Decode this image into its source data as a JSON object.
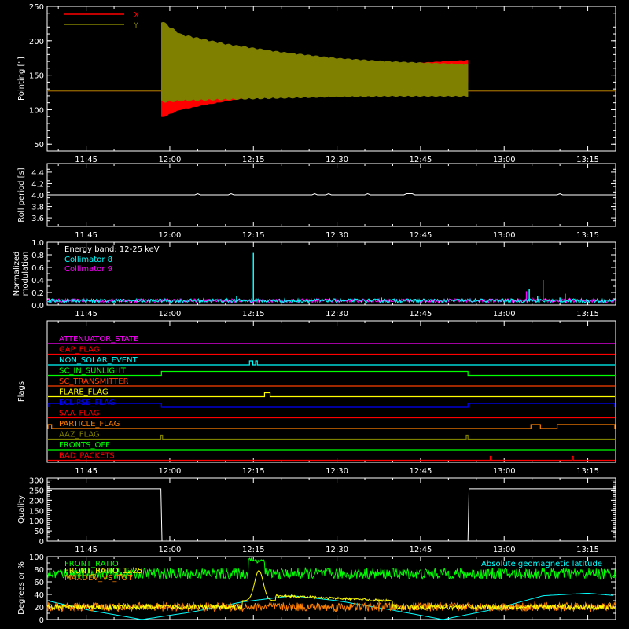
{
  "chart_data": [
    {
      "type": "line",
      "ylabel": "Pointing [\"]",
      "ylim": [
        40,
        250
      ],
      "yticks": [
        50,
        100,
        150,
        200,
        250
      ],
      "xlim": [
        38,
        140
      ],
      "xtick_minutes": [
        45,
        60,
        75,
        90,
        105,
        120,
        135
      ],
      "xtick_labels": [
        "11:45",
        "12:00",
        "12:15",
        "12:30",
        "12:45",
        "13:00",
        "13:15"
      ],
      "legend": [
        {
          "name": "X",
          "color": "#ff0000"
        },
        {
          "name": "Y",
          "color": "#808000"
        }
      ],
      "series": [
        {
          "name": "X",
          "color": "#ff0000",
          "x_start": 58.5,
          "x_end": 113.5,
          "flat_value": 127,
          "band_upper": [
            [
              58.5,
              145
            ],
            [
              62,
              143
            ],
            [
              70,
              145
            ],
            [
              80,
              152
            ],
            [
              90,
              160
            ],
            [
              100,
              166
            ],
            [
              113.5,
              172
            ]
          ],
          "band_lower": [
            [
              58.5,
              88
            ],
            [
              62,
              100
            ],
            [
              70,
              112
            ],
            [
              80,
              124
            ],
            [
              90,
              130
            ],
            [
              100,
              136
            ],
            [
              113.5,
              140
            ]
          ]
        },
        {
          "name": "Y",
          "color": "#808000",
          "x_start": 58.5,
          "x_end": 113.5,
          "flat_value": 127,
          "band_upper": [
            [
              58.5,
              230
            ],
            [
              62,
              210
            ],
            [
              70,
              196
            ],
            [
              80,
              184
            ],
            [
              90,
              175
            ],
            [
              100,
              170
            ],
            [
              113.5,
              166
            ]
          ],
          "band_lower": [
            [
              58.5,
              110
            ],
            [
              62,
              112
            ],
            [
              70,
              114
            ],
            [
              80,
              116
            ],
            [
              90,
              118
            ],
            [
              100,
              119
            ],
            [
              113.5,
              119
            ]
          ]
        }
      ]
    },
    {
      "type": "line",
      "ylabel": "Roll period [s]",
      "ylim": [
        3.45,
        4.55
      ],
      "yticks": [
        3.6,
        3.8,
        4.0,
        4.2,
        4.4
      ],
      "ytick_labels": [
        "3.6",
        "3.8",
        "4.0",
        "4.2",
        "4.4"
      ],
      "xlim": [
        38,
        140
      ],
      "xtick_labels": [
        "11:45",
        "12:00",
        "12:15",
        "12:30",
        "12:45",
        "13:00",
        "13:15"
      ],
      "series": [
        {
          "name": "Roll period",
          "color": "#ffffff",
          "value": 4.0
        }
      ]
    },
    {
      "type": "line",
      "ylabel": "Normalized modulation",
      "ylim": [
        0,
        1.0
      ],
      "yticks": [
        0,
        0.2,
        0.4,
        0.6,
        0.8,
        1.0
      ],
      "ytick_labels": [
        "0.0",
        "0.2",
        "0.4",
        "0.6",
        "0.8",
        "1.0"
      ],
      "xlim": [
        38,
        140
      ],
      "xtick_labels": [
        "11:45",
        "12:00",
        "12:15",
        "12:30",
        "12:45",
        "13:00",
        "13:15"
      ],
      "annotation": "Energy band: 12-25 keV",
      "series": [
        {
          "name": "Collimator 8",
          "color": "#00ffff",
          "baseline": 0.07,
          "spikes": [
            [
              75,
              0.83
            ],
            [
              72,
              0.15
            ],
            [
              98,
              0.12
            ],
            [
              124.5,
              0.25
            ],
            [
              126,
              0.15
            ],
            [
              130,
              0.12
            ]
          ]
        },
        {
          "name": "Collimator 9",
          "color": "#ff00ff",
          "baseline": 0.07,
          "spikes": [
            [
              124,
              0.22
            ],
            [
              127,
              0.4
            ],
            [
              131,
              0.18
            ],
            [
              125,
              0.12
            ]
          ]
        }
      ]
    },
    {
      "type": "line",
      "ylabel": "Flags",
      "xlim": [
        38,
        140
      ],
      "xtick_labels": [
        "11:45",
        "12:00",
        "12:15",
        "12:30",
        "12:45",
        "13:00",
        "13:15"
      ],
      "flags": [
        {
          "label": "ATTENUATOR_STATE",
          "color": "#ff00ff",
          "steps": []
        },
        {
          "label": "GAP_FLAG",
          "color": "#ff0000",
          "steps": []
        },
        {
          "label": "NON_SOLAR_EVENT",
          "color": "#00ffff",
          "steps": [
            [
              74.3,
              74.9
            ],
            [
              75.4,
              75.7
            ]
          ]
        },
        {
          "label": "SC_IN_SUNLIGHT",
          "color": "#00ff00",
          "steps": [
            [
              58.5,
              113.5
            ]
          ]
        },
        {
          "label": "SC_TRANSMITTER",
          "color": "#ff4000",
          "steps": []
        },
        {
          "label": "FLARE_FLAG",
          "color": "#ffff00",
          "steps": [
            [
              77.0,
              78.0
            ]
          ]
        },
        {
          "label": "ECLIPSE_FLAG",
          "color": "#0000ff",
          "steps": [
            [
              38,
              58.5
            ],
            [
              113.5,
              140
            ]
          ]
        },
        {
          "label": "SAA_FLAG",
          "color": "#ff0000",
          "steps": []
        },
        {
          "label": "PARTICLE_FLAG",
          "color": "#ff8000",
          "steps": [
            [
              38,
              38.8
            ],
            [
              124.8,
              126.5
            ],
            [
              129.5,
              140
            ]
          ]
        },
        {
          "label": "AAZ_FLAG",
          "color": "#808000",
          "steps": [
            [
              58.4,
              58.7
            ],
            [
              113.2,
              113.5
            ]
          ]
        },
        {
          "label": "FRONTS_OFF",
          "color": "#00ff00",
          "steps": []
        },
        {
          "label": "BAD_PACKETS",
          "color": "#ff0000",
          "steps": [
            [
              117.5,
              117.7
            ],
            [
              132.2,
              132.4
            ]
          ]
        }
      ]
    },
    {
      "type": "line",
      "ylabel": "Quality",
      "ylim": [
        0,
        310
      ],
      "yticks": [
        0,
        50,
        100,
        150,
        200,
        250,
        300
      ],
      "xlim": [
        38,
        140
      ],
      "xtick_labels": [
        "11:45",
        "12:00",
        "12:15",
        "12:30",
        "12:45",
        "13:00",
        "13:15"
      ],
      "series": [
        {
          "name": "Quality",
          "color": "#ffffff",
          "points": [
            [
              38,
              256
            ],
            [
              58.4,
              256
            ],
            [
              58.6,
              0
            ],
            [
              113.5,
              0
            ],
            [
              113.7,
              256
            ],
            [
              140,
              256
            ]
          ]
        }
      ]
    },
    {
      "type": "line",
      "ylabel": "Degrees or %",
      "ylim": [
        0,
        100
      ],
      "yticks": [
        0,
        20,
        40,
        60,
        80,
        100
      ],
      "xlim": [
        38,
        140
      ],
      "legend": [
        {
          "name": "FRONT_RATIO",
          "color": "#00ff00"
        },
        {
          "name": "FRONT_RATIO_1225",
          "color": "#ffff00"
        },
        {
          "name": "MAXDEV_VS_TOT",
          "color": "#ff8000"
        },
        {
          "name": "Absolute geomagnetic latitude",
          "color": "#00ffff"
        }
      ],
      "series": [
        {
          "name": "FRONT_RATIO",
          "color": "#00ff00",
          "mean": 73,
          "noise": 9
        },
        {
          "name": "FRONT_RATIO_1225",
          "color": "#ffff00",
          "bump_center": 76,
          "bump_peak": 78
        },
        {
          "name": "MAXDEV_VS_TOT",
          "color": "#ff8000",
          "mean": 20,
          "noise": 7
        },
        {
          "name": "Absolute geomagnetic latitude",
          "color": "#00ffff",
          "points": [
            [
              38,
              30
            ],
            [
              46,
              14
            ],
            [
              55,
              0
            ],
            [
              64,
              12
            ],
            [
              73,
              28
            ],
            [
              82,
              38
            ],
            [
              90,
              30
            ],
            [
              100,
              15
            ],
            [
              109,
              0
            ],
            [
              118,
              16
            ],
            [
              127,
              38
            ],
            [
              135,
              42
            ],
            [
              140,
              38
            ]
          ]
        }
      ]
    }
  ]
}
